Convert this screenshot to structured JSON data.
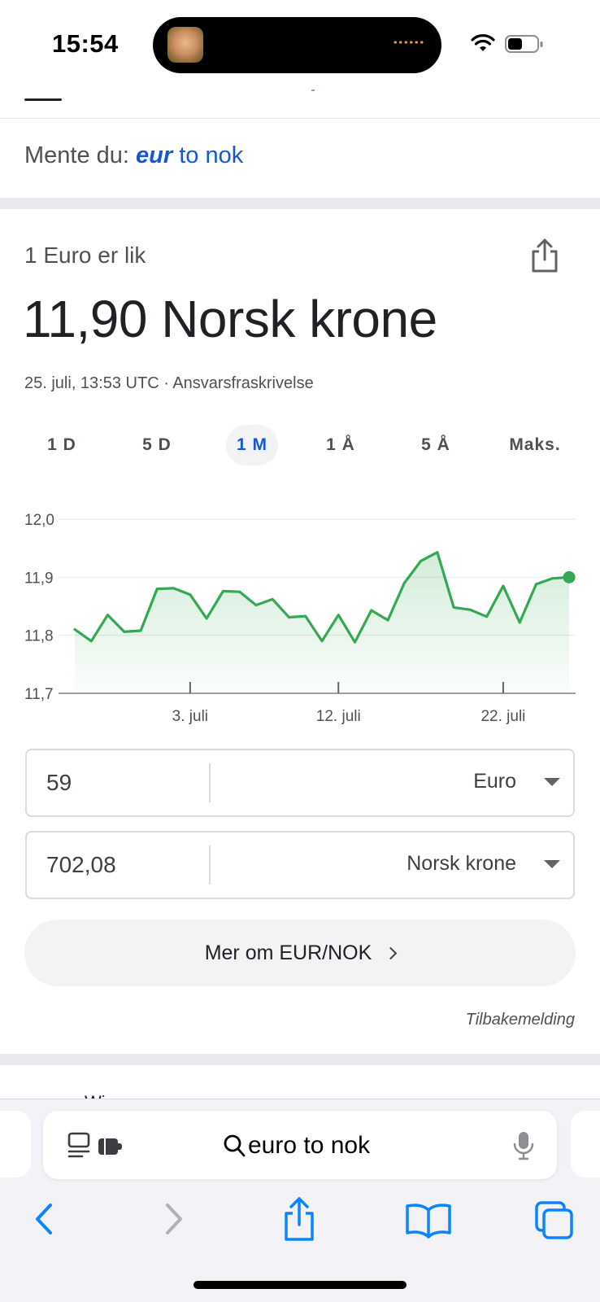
{
  "status_bar": {
    "time": "15:54"
  },
  "did_you_mean": {
    "prefix": "Mente du: ",
    "bold_term": "eur",
    "rest": " to nok"
  },
  "rate_card": {
    "equals_label": "1 Euro er lik",
    "rate_text": "11,90 Norsk krone",
    "timestamp": "25. juli, 13:53 UTC",
    "separator": " · ",
    "disclaimer": "Ansvarsfraskrivelse",
    "ranges": [
      "1 D",
      "5 D",
      "1 M",
      "1 Å",
      "5 Å",
      "Maks."
    ],
    "active_range": "1 M",
    "accent_color": "#1558d6"
  },
  "chart_data": {
    "type": "area",
    "y_ticks": [
      "12,0",
      "11,9",
      "11,8",
      "11,7"
    ],
    "x_ticks": [
      "3. juli",
      "12. juli",
      "22. juli"
    ],
    "ylim": [
      11.7,
      12.0
    ],
    "line_color": "#34a853",
    "series": [
      {
        "values": [
          11.81,
          11.79,
          11.835,
          11.806,
          11.808,
          11.88,
          11.881,
          11.87,
          11.829,
          11.876,
          11.875,
          11.852,
          11.862,
          11.831,
          11.833,
          11.79,
          11.835,
          11.788,
          11.843,
          11.826,
          11.89,
          11.928,
          11.943,
          11.848,
          11.844,
          11.832,
          11.885,
          11.822,
          11.888,
          11.898,
          11.9
        ]
      }
    ]
  },
  "converter": {
    "from": {
      "value": "59",
      "unit": "Euro"
    },
    "to": {
      "value": "702,08",
      "unit": "Norsk krone"
    }
  },
  "more_button": {
    "label": "Mer om EUR/NOK"
  },
  "feedback": {
    "label": "Tilbakemelding"
  },
  "next_result": {
    "partial_text": "Wi"
  },
  "safari": {
    "address_text": "euro to nok"
  }
}
